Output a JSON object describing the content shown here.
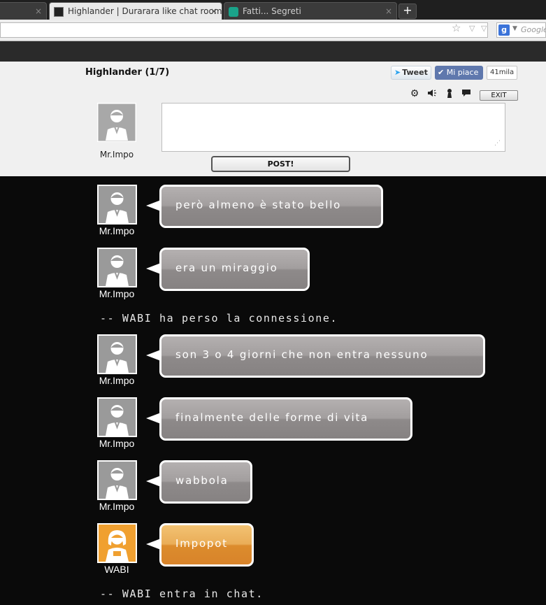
{
  "browser": {
    "tabs": [
      {
        "label": "",
        "close": "×"
      },
      {
        "label": "Highlander | Durarara like chat room |...",
        "close": "×"
      },
      {
        "label": "Fatti... Segreti",
        "close": "×"
      }
    ],
    "new_tab": "+",
    "search_engine_placeholder": "Google",
    "search_logo": "g"
  },
  "header": {
    "room_title": "Highlander (1/7)",
    "tweet_label": "Tweet",
    "like_label": "Mi piace",
    "like_count": "41mila",
    "exit_label": "EXIT",
    "post_label": "POST!",
    "current_user": "Mr.Impo",
    "message_value": "",
    "tools": [
      "gear-icon",
      "speaker-icon",
      "user-icon",
      "speech-icon"
    ]
  },
  "chat": {
    "messages": [
      {
        "user": "Mr.Impo",
        "text": "però almeno è stato bello",
        "avatar": "gray"
      },
      {
        "user": "Mr.Impo",
        "text": "era un miraggio",
        "avatar": "gray"
      },
      {
        "user": "Mr.Impo",
        "text": "son 3 o 4 giorni che non entra nessuno",
        "avatar": "gray"
      },
      {
        "user": "Mr.Impo",
        "text": "finalmente delle forme di vita",
        "avatar": "gray"
      },
      {
        "user": "Mr.Impo",
        "text": "wabbola",
        "avatar": "gray"
      },
      {
        "user": "WABI",
        "text": "Impopot",
        "avatar": "orange"
      }
    ],
    "system": [
      "-- WABI ha perso la connessione.",
      "-- WABI entra in chat."
    ]
  },
  "colors": {
    "bubble_gray": "#9a9696",
    "bubble_orange": "#e39a3c",
    "chat_bg": "#0a0a0a",
    "header_bg": "#f0f0f0"
  }
}
